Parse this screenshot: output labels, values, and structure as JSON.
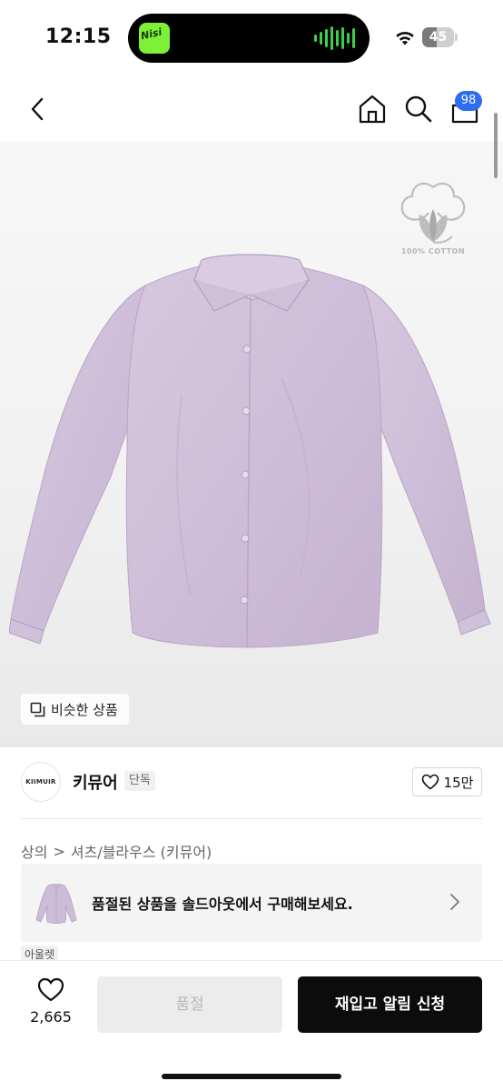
{
  "status_bar": {
    "time": "12:15",
    "battery_level": "45",
    "battery_fraction": 0.45
  },
  "nav": {
    "back_icon": "chevron-left-icon",
    "home_icon": "home-icon",
    "search_icon": "search-icon",
    "cart_icon": "cart-icon",
    "cart_count": "98"
  },
  "hero": {
    "cotton_label": "100% COTTON",
    "similar_label": "비슷한 상품"
  },
  "brand": {
    "logo_text": "KIIMUIR",
    "name": "키뮤어",
    "tag": "단독",
    "likes": "15만"
  },
  "breadcrumb": {
    "category": "상의",
    "separator": ">",
    "subcategory": "셔츠/블라우스 (키뮤어)"
  },
  "soldout_banner": {
    "message": "품절된 상품을 솔드아웃에서 구매해보세요."
  },
  "outlet_tag": "아울렛",
  "bottom_bar": {
    "wish_count": "2,665",
    "soldout_label": "품절",
    "restock_label": "재입고 알림 신청"
  },
  "colors": {
    "accent_badge": "#2f6df0",
    "primary_button": "#0c0c0c",
    "disabled_button": "#ececec",
    "shirt": "#d3c4dc"
  }
}
